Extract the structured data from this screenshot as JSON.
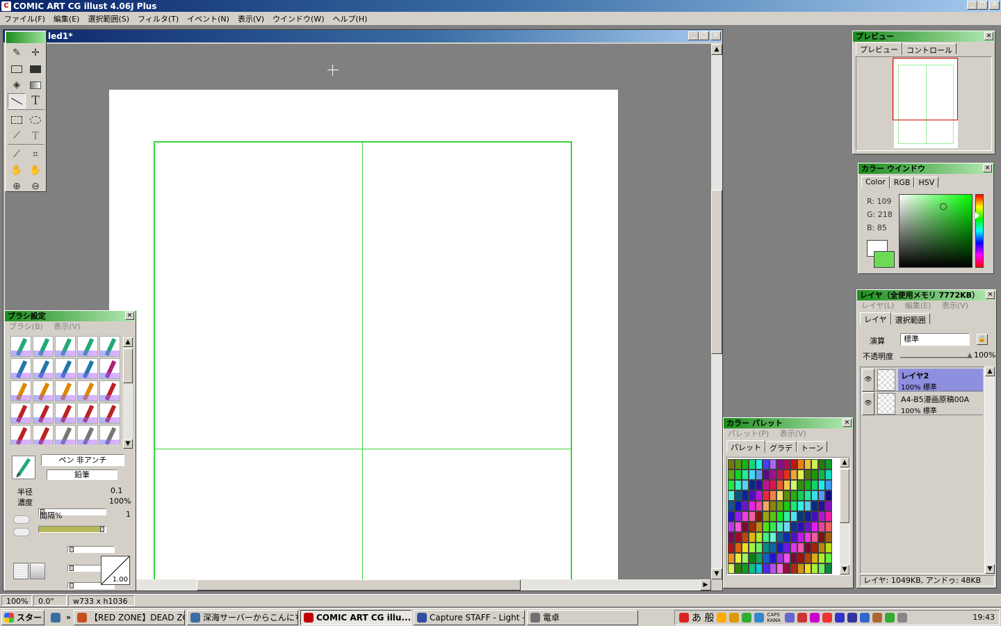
{
  "app": {
    "title": "COMIC ART CG illust 4.06J Plus"
  },
  "menu": [
    "ファイル(F)",
    "編集(E)",
    "選択範囲(S)",
    "フィルタ(T)",
    "イベント(N)",
    "表示(V)",
    "ウインドウ(W)",
    "ヘルプ(H)"
  ],
  "document": {
    "title": "led1*"
  },
  "preview": {
    "title": "プレビュー",
    "tabs": [
      "プレビュー",
      "コントロール"
    ]
  },
  "color_window": {
    "title": "カラー ウインドウ",
    "tabs": [
      "Color",
      "RGB",
      "HSV"
    ],
    "r_label": "R: 109",
    "g_label": "G: 218",
    "b_label": "B:  85",
    "foreground": "#6dda55",
    "background": "#ffffff"
  },
  "layers": {
    "title": "レイヤ（全使用メモリ 7772KB）",
    "menu": [
      "レイヤ(L)",
      "編集(E)",
      "表示(V)"
    ],
    "tabs": [
      "レイヤ",
      "選択範囲"
    ],
    "blend_label": "演算",
    "blend_value": "標準",
    "opacity_label": "不透明度",
    "opacity_value": "100%",
    "items": [
      {
        "name": "レイヤ2",
        "info": "100% 標準",
        "selected": true
      },
      {
        "name": "A4-B5漫画原稿00A",
        "info": "100% 標準",
        "selected": false
      }
    ],
    "footer": "レイヤ: 1049KB, アンドゥ: 48KB"
  },
  "color_palette": {
    "title": "カラー パレット",
    "menu": [
      "パレット(P)",
      "表示(V)"
    ],
    "tabs": [
      "パレット",
      "グラデ",
      "トーン"
    ]
  },
  "brush": {
    "title": "ブラシ設定",
    "menu": [
      "ブラシ(B)",
      "表示(V)"
    ],
    "name1": "ペン 非アンチ",
    "name2": "鉛筆",
    "radius_label": "半径",
    "radius_value": "0.1",
    "density_label": "濃度",
    "density_value": "100%",
    "spacing_label": "間隔%",
    "spacing_value": "1",
    "pressure_value": "1.00"
  },
  "status": {
    "zoom": "100%",
    "angle": "0.0°",
    "size": "w733 x h1036"
  },
  "taskbar": {
    "start": "スタート",
    "items": [
      {
        "label": "【RED ZONE】DEAD ZO...",
        "active": false,
        "color": "#c8501e"
      },
      {
        "label": "深海サーバーからこんにち...",
        "active": false,
        "color": "#3a6ea5"
      },
      {
        "label": "COMIC ART CG illu...",
        "active": true,
        "color": "#c00000"
      },
      {
        "label": "Capture STAFF - Light -",
        "active": false,
        "color": "#3050a0"
      },
      {
        "label": "電卓",
        "active": false,
        "color": "#707070"
      }
    ],
    "ime": "あ 般",
    "caps": "CAPS KANA",
    "clock": "19:43"
  }
}
